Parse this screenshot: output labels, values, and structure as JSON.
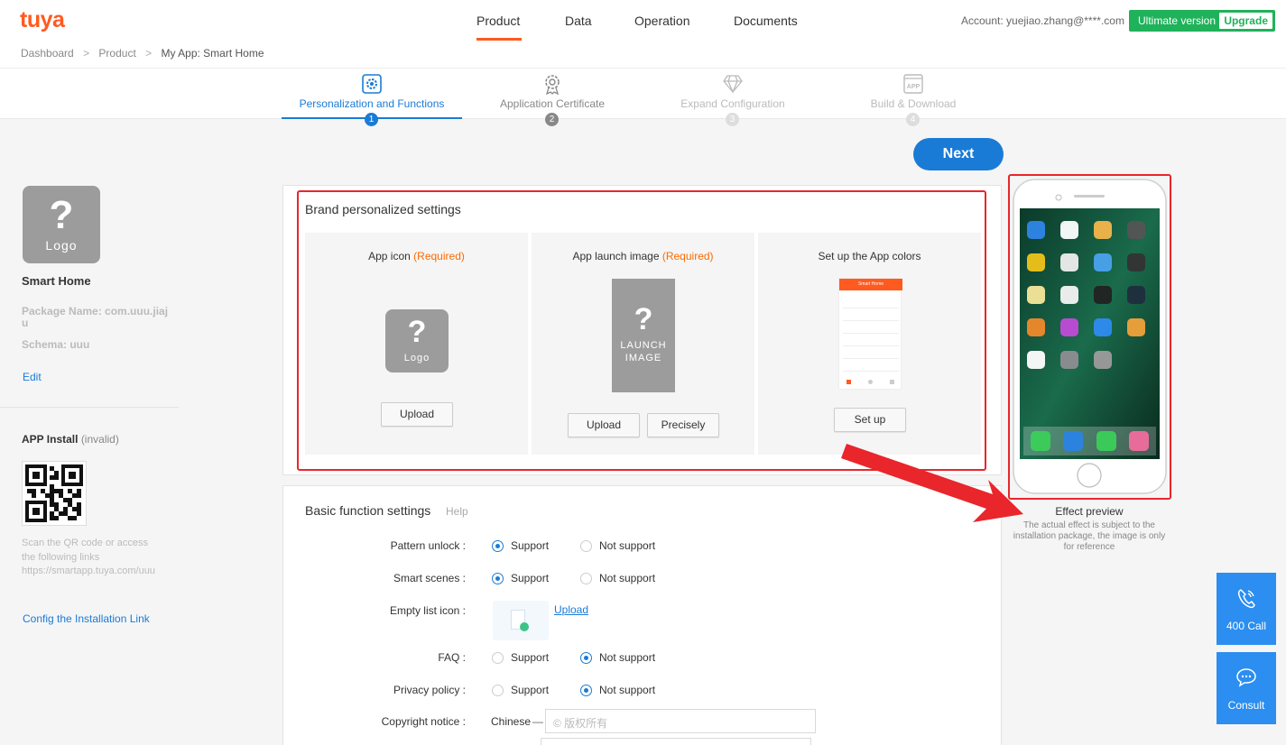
{
  "header": {
    "logo": "tuya",
    "nav": [
      "Product",
      "Data",
      "Operation",
      "Documents"
    ],
    "active_nav": "Product",
    "account": "Account: yuejiao.zhang@****.com",
    "ultimate_label": "Ultimate version",
    "upgrade_label": "Upgrade"
  },
  "breadcrumb": {
    "items": [
      "Dashboard",
      "Product",
      "My App: Smart Home"
    ],
    "separator": ">"
  },
  "steps": [
    {
      "label": "Personalization and Functions",
      "num": "1",
      "icon": "gear-icon"
    },
    {
      "label": "Application Certificate",
      "num": "2",
      "icon": "certificate-icon"
    },
    {
      "label": "Expand Configuration",
      "num": "3",
      "icon": "diamond-icon"
    },
    {
      "label": "Build & Download",
      "num": "4",
      "icon": "app-icon"
    }
  ],
  "sidebar": {
    "logo_q": "?",
    "logo_text": "Logo",
    "app_name": "Smart Home",
    "package_label": "Package Name: com.uuu.jiaju",
    "schema_label": "Schema: uuu",
    "edit_label": "Edit",
    "install_title": "APP Install",
    "install_status": "(invalid)",
    "scan_text": "Scan the QR code or access the following links",
    "install_url": "https://smartapp.tuya.com/uuu",
    "config_link": "Config the Installation Link"
  },
  "next_button": "Next",
  "brand": {
    "title": "Brand personalized settings",
    "app_icon_label": "App icon ",
    "required": "(Required)",
    "launch_label": "App launch image ",
    "colors_label": "Set up the App colors",
    "upload": "Upload",
    "precisely": "Precisely",
    "setup": "Set up",
    "logo_q": "?",
    "logo_text": "Logo",
    "launch_q": "?",
    "launch_line1": "Launch",
    "launch_line2": "Image",
    "mock_title": "Smart Home"
  },
  "basic": {
    "title": "Basic function settings",
    "help": "Help",
    "rows": [
      {
        "label": "Pattern unlock :",
        "support": "Support",
        "not_support": "Not support",
        "selected": "support"
      },
      {
        "label": "Smart scenes :",
        "support": "Support",
        "not_support": "Not support",
        "selected": "support"
      },
      {
        "label": "FAQ :",
        "support": "Support",
        "not_support": "Not support",
        "selected": "not_support"
      },
      {
        "label": "Privacy policy :",
        "support": "Support",
        "not_support": "Not support",
        "selected": "not_support"
      }
    ],
    "empty_label": "Empty list icon :",
    "empty_upload": "Upload",
    "copyright_label": "Copyright notice :",
    "copyright_lang": "Chinese",
    "copyright_dash": "—",
    "copyright_placeholder": "© 版权所有"
  },
  "preview": {
    "title": "Effect preview",
    "note": "The actual effect is subject to the installation package, the image is only for reference"
  },
  "fab": {
    "call": "400 Call",
    "consult": "Consult"
  },
  "colors": {
    "accent": "#1a7bd6",
    "brand_orange": "#ff5a1f",
    "green": "#1fb25a",
    "annotation_red": "#e8262b"
  }
}
